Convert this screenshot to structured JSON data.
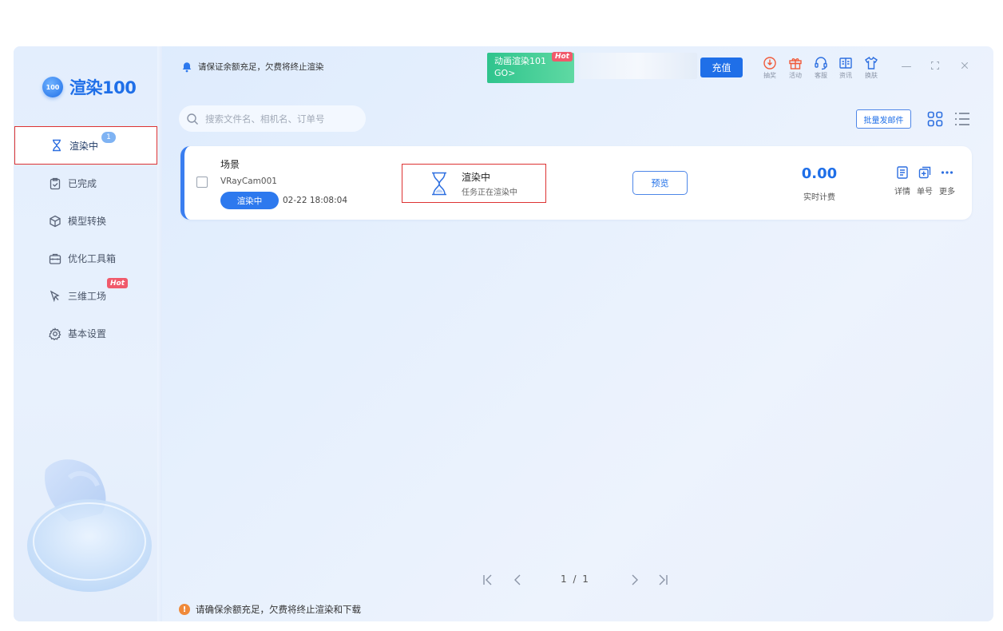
{
  "app": {
    "logo_badge": "100",
    "logo_text": "渲染100"
  },
  "sidebar": {
    "items": [
      {
        "label": "渲染中",
        "badge": "1"
      },
      {
        "label": "已完成"
      },
      {
        "label": "模型转换"
      },
      {
        "label": "优化工具箱"
      },
      {
        "label": "三维工场",
        "hot": "Hot"
      },
      {
        "label": "基本设置"
      }
    ]
  },
  "header": {
    "notice": "请保证余额充足，欠费将终止渲染",
    "promo": {
      "title": "动画渲染101",
      "go": "GO>",
      "hot": "Hot"
    },
    "recharge": "充值",
    "tools": [
      {
        "label": "抽奖",
        "icon": "lottery-icon"
      },
      {
        "label": "活动",
        "icon": "gift-icon"
      },
      {
        "label": "客服",
        "icon": "headset-icon"
      },
      {
        "label": "资讯",
        "icon": "news-icon"
      },
      {
        "label": "换肤",
        "icon": "shirt-icon"
      }
    ]
  },
  "toolbar": {
    "search_placeholder": "搜索文件名、相机名、订单号",
    "batch_label": "批量发邮件"
  },
  "job": {
    "scene": "场景",
    "camera": "VRayCam001",
    "status_pill": "渲染中",
    "timestamp": "02-22 18:08:04",
    "status_title": "渲染中",
    "status_sub": "任务正在渲染中",
    "preview": "预览",
    "cost": "0.00",
    "cost_label": "实时计费",
    "actions": [
      {
        "label": "详情",
        "icon": "details-icon"
      },
      {
        "label": "单号",
        "icon": "copy-order-icon"
      },
      {
        "label": "更多",
        "icon": "more-icon"
      }
    ]
  },
  "pagination": {
    "indicator": "1 / 1"
  },
  "footer": {
    "notice": "请确保余额充足，欠费将终止渲染和下载"
  },
  "colors": {
    "accent": "#1f6fe8",
    "promo": "#2fc48d",
    "hot": "#f05a6b",
    "warn": "#f08a3a",
    "highlight_border": "#dd3333"
  }
}
